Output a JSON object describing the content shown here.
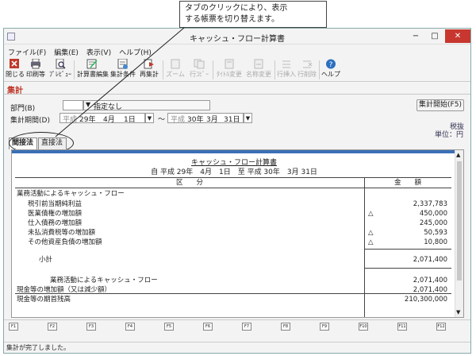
{
  "callout": {
    "line1": "タブのクリックにより、表示",
    "line2": "する帳票を切り替えます。"
  },
  "window": {
    "title": "キャッシュ・フロー計算書",
    "minimize": "−",
    "maximize": "□",
    "close": "✕"
  },
  "menu": [
    "ファイル(F)",
    "編集(E)",
    "表示(V)",
    "ヘルプ(H)"
  ],
  "toolbar": [
    {
      "label": "閉じる",
      "icon": "close-icon",
      "enabled": true
    },
    {
      "label": "印刷等",
      "icon": "printer-icon",
      "enabled": true
    },
    {
      "label": "ﾌﾟﾚﾋﾞｭｰ",
      "icon": "preview-icon",
      "enabled": true
    },
    {
      "label": "計算書編集",
      "icon": "edit-icon",
      "enabled": true
    },
    {
      "label": "集計条件",
      "icon": "conditions-icon",
      "enabled": true
    },
    {
      "label": "再集計",
      "icon": "recalc-icon",
      "enabled": true
    },
    {
      "label": "ズーム",
      "icon": "zoom-icon",
      "enabled": false
    },
    {
      "label": "行ｺﾋﾟｰ",
      "icon": "row-copy-icon",
      "enabled": false
    },
    {
      "label": "ﾀｲﾄﾙ変更",
      "icon": "title-change-icon",
      "enabled": false
    },
    {
      "label": "名称変更",
      "icon": "rename-icon",
      "enabled": false
    },
    {
      "label": "行挿入",
      "icon": "row-insert-icon",
      "enabled": false
    },
    {
      "label": "行削除",
      "icon": "row-delete-icon",
      "enabled": false
    },
    {
      "label": "ヘルプ",
      "icon": "help-icon",
      "enabled": true
    }
  ],
  "section": "集計",
  "form": {
    "dept_label": "部門(B)",
    "dept_value": "指定なし",
    "period_label": "集計期間(D)",
    "from_era": "平成",
    "from_year": "29年",
    "from_month": "4月",
    "from_day": "1日",
    "tilde": "〜",
    "to_era": "平成",
    "to_year": "30年",
    "to_month": "3月",
    "to_day": "31日",
    "start_button": "集計開始(F5)",
    "tax_note": "税抜",
    "unit": "単位：円"
  },
  "tabs": [
    "間接法",
    "直接法"
  ],
  "report": {
    "title": "キャッシュ・フロー計算書",
    "period": "自 平成 29年　4月　1日　至 平成 30年　3月 31日",
    "col_section": "区　　分",
    "col_amount": "金　　額",
    "rows": [
      {
        "label": "業務活動によるキャッシュ・フロー",
        "indent": 0,
        "tri": "",
        "amount": ""
      },
      {
        "label": "税引前当期純利益",
        "indent": 1,
        "tri": "",
        "amount": "2,337,783"
      },
      {
        "label": "医業債権の増加額",
        "indent": 1,
        "tri": "△",
        "amount": "450,000"
      },
      {
        "label": "仕入債務の増加額",
        "indent": 1,
        "tri": "",
        "amount": "245,000"
      },
      {
        "label": "未払消費税等の増加額",
        "indent": 1,
        "tri": "△",
        "amount": "50,593"
      },
      {
        "label": "その他資産負債の増加額",
        "indent": 1,
        "tri": "△",
        "amount": "10,800"
      },
      {
        "label": "小計",
        "indent": 2,
        "tri": "",
        "amount": "2,071,400"
      },
      {
        "label": "業務活動によるキャッシュ・フロー",
        "indent": 3,
        "tri": "",
        "amount": "2,071,400"
      },
      {
        "label": "現金等の増加額（又は減少額）",
        "indent": 0,
        "tri": "",
        "amount": "2,071,400"
      },
      {
        "label": "現金等の期首残高",
        "indent": 0,
        "tri": "",
        "amount": "210,300,000"
      }
    ]
  },
  "fkeys": [
    "F1",
    "F2",
    "F3",
    "F4",
    "F5",
    "F6",
    "F7",
    "F8",
    "F9",
    "F10",
    "F11",
    "F12"
  ],
  "status": "集計が完了しました。"
}
